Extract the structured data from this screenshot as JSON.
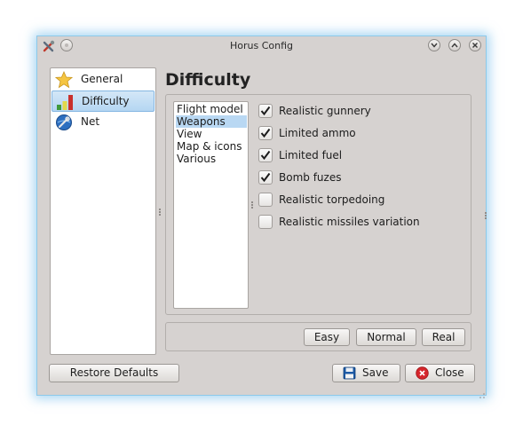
{
  "window": {
    "title": "Horus Config"
  },
  "sidebar": {
    "items": [
      {
        "label": "General",
        "icon": "star-icon",
        "selected": false
      },
      {
        "label": "Difficulty",
        "icon": "bar-chart-icon",
        "selected": true
      },
      {
        "label": "Net",
        "icon": "wrench-globe-icon",
        "selected": false
      }
    ]
  },
  "page": {
    "title": "Difficulty"
  },
  "subcategories": {
    "items": [
      "Flight model",
      "Weapons",
      "View",
      "Map & icons",
      "Various"
    ],
    "selected": "Weapons"
  },
  "options": [
    {
      "label": "Realistic gunnery",
      "checked": true
    },
    {
      "label": "Limited ammo",
      "checked": true
    },
    {
      "label": "Limited fuel",
      "checked": true
    },
    {
      "label": "Bomb fuzes",
      "checked": true
    },
    {
      "label": "Realistic torpedoing",
      "checked": false
    },
    {
      "label": "Realistic missiles variation",
      "checked": false
    }
  ],
  "presets": {
    "easy": "Easy",
    "normal": "Normal",
    "real": "Real"
  },
  "footer": {
    "restore": "Restore Defaults",
    "save": "Save",
    "close": "Close"
  },
  "colors": {
    "accent": "#84b6e2",
    "selection": "#b9d8f3",
    "window_bg": "#d6d2d0",
    "close_red": "#d6262c",
    "save_blue": "#1d5aa5"
  }
}
